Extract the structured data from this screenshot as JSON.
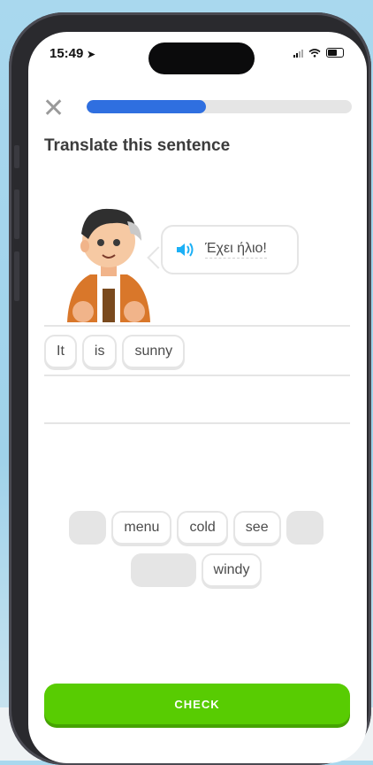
{
  "status_bar": {
    "time": "15:49"
  },
  "lesson": {
    "progress": 0.45,
    "title": "Translate this sentence",
    "prompt_text": "Έχει ήλιο!"
  },
  "answer": {
    "chips": [
      "It",
      "is",
      "sunny"
    ]
  },
  "word_bank": {
    "row1": [
      "",
      "menu",
      "cold",
      "see",
      ""
    ],
    "row2": [
      "",
      "windy"
    ]
  },
  "footer": {
    "check_label": "CHECK"
  },
  "colors": {
    "accent_green": "#58cc02",
    "progress_blue": "#2f6fe0",
    "speaker_blue": "#1cb0f6"
  },
  "icons": {
    "close": "close-icon",
    "speaker": "speaker-icon",
    "location": "location-arrow-icon"
  }
}
